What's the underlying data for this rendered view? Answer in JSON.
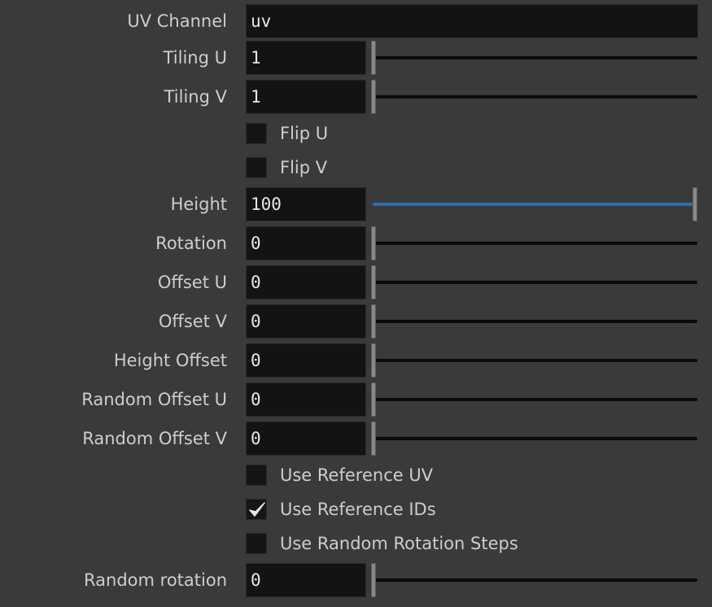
{
  "uv_channel": {
    "label": "UV Channel",
    "value": "uv"
  },
  "sliders": [
    {
      "label": "Tiling U",
      "value": "1",
      "fraction": 0.0
    },
    {
      "label": "Tiling V",
      "value": "1",
      "fraction": 0.0
    },
    {
      "label": "Height",
      "value": "100",
      "fraction": 1.0
    },
    {
      "label": "Rotation",
      "value": "0",
      "fraction": 0.0
    },
    {
      "label": "Offset U",
      "value": "0",
      "fraction": 0.0
    },
    {
      "label": "Offset V",
      "value": "0",
      "fraction": 0.0
    },
    {
      "label": "Height Offset",
      "value": "0",
      "fraction": 0.0
    },
    {
      "label": "Random Offset U",
      "value": "0",
      "fraction": 0.0
    },
    {
      "label": "Random Offset V",
      "value": "0",
      "fraction": 0.0
    },
    {
      "label": "Random rotation",
      "value": "0",
      "fraction": 0.0
    }
  ],
  "checkboxes": [
    {
      "label": "Flip U",
      "checked": false
    },
    {
      "label": "Flip V",
      "checked": false
    },
    {
      "label": "Use Reference UV",
      "checked": false
    },
    {
      "label": "Use Reference IDs",
      "checked": true
    },
    {
      "label": "Use Random Rotation Steps",
      "checked": false
    }
  ],
  "colors": {
    "background": "#3a3a3a",
    "field": "#131313",
    "slider_fill": "#2f6ea8"
  }
}
